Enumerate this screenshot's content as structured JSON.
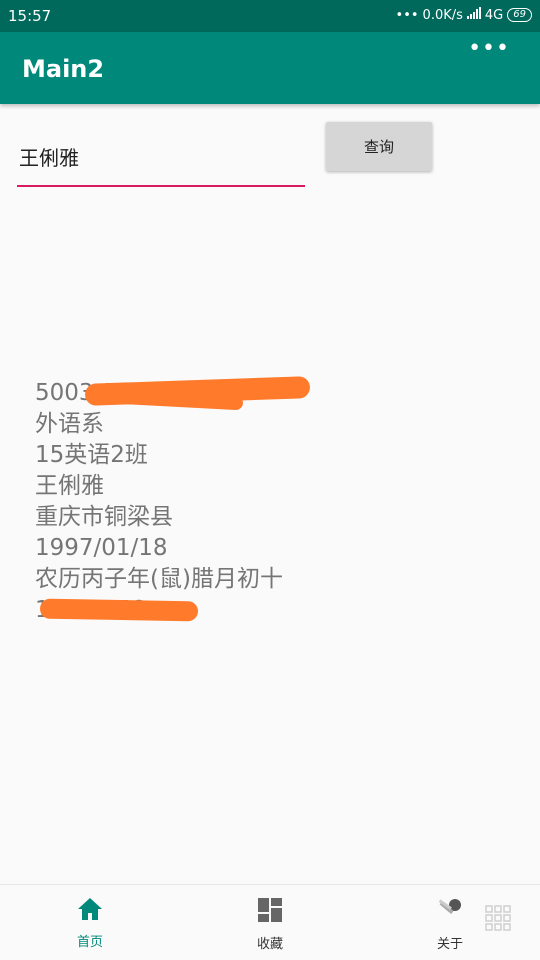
{
  "status_bar": {
    "time": "15:57",
    "network_speed": "0.0K/s",
    "network_type": "4G",
    "battery": "69"
  },
  "app_bar": {
    "title": "Main2",
    "overflow_icon": "more-dots-icon"
  },
  "search": {
    "value": "王俐雅",
    "button_label": "查询"
  },
  "result": {
    "id_number_visible": "5003                 1384",
    "department": "外语系",
    "class_name": "15英语2班",
    "name": "王俐雅",
    "hometown": "重庆市铜梁县",
    "birth_date": "1997/01/18",
    "lunar_birth": "农历丙子年(鼠)腊月初十",
    "phone_visible": "15        49776"
  },
  "bottom_nav": {
    "items": [
      {
        "label": "首页",
        "icon": "home-icon",
        "active": true
      },
      {
        "label": "收藏",
        "icon": "dashboard-icon",
        "active": false
      },
      {
        "label": "关于",
        "icon": "key-icon",
        "active": false
      }
    ]
  },
  "colors": {
    "status_bar": "#00695c",
    "app_bar": "#00897b",
    "accent": "#d81b60",
    "redaction": "#ff7a2a"
  }
}
